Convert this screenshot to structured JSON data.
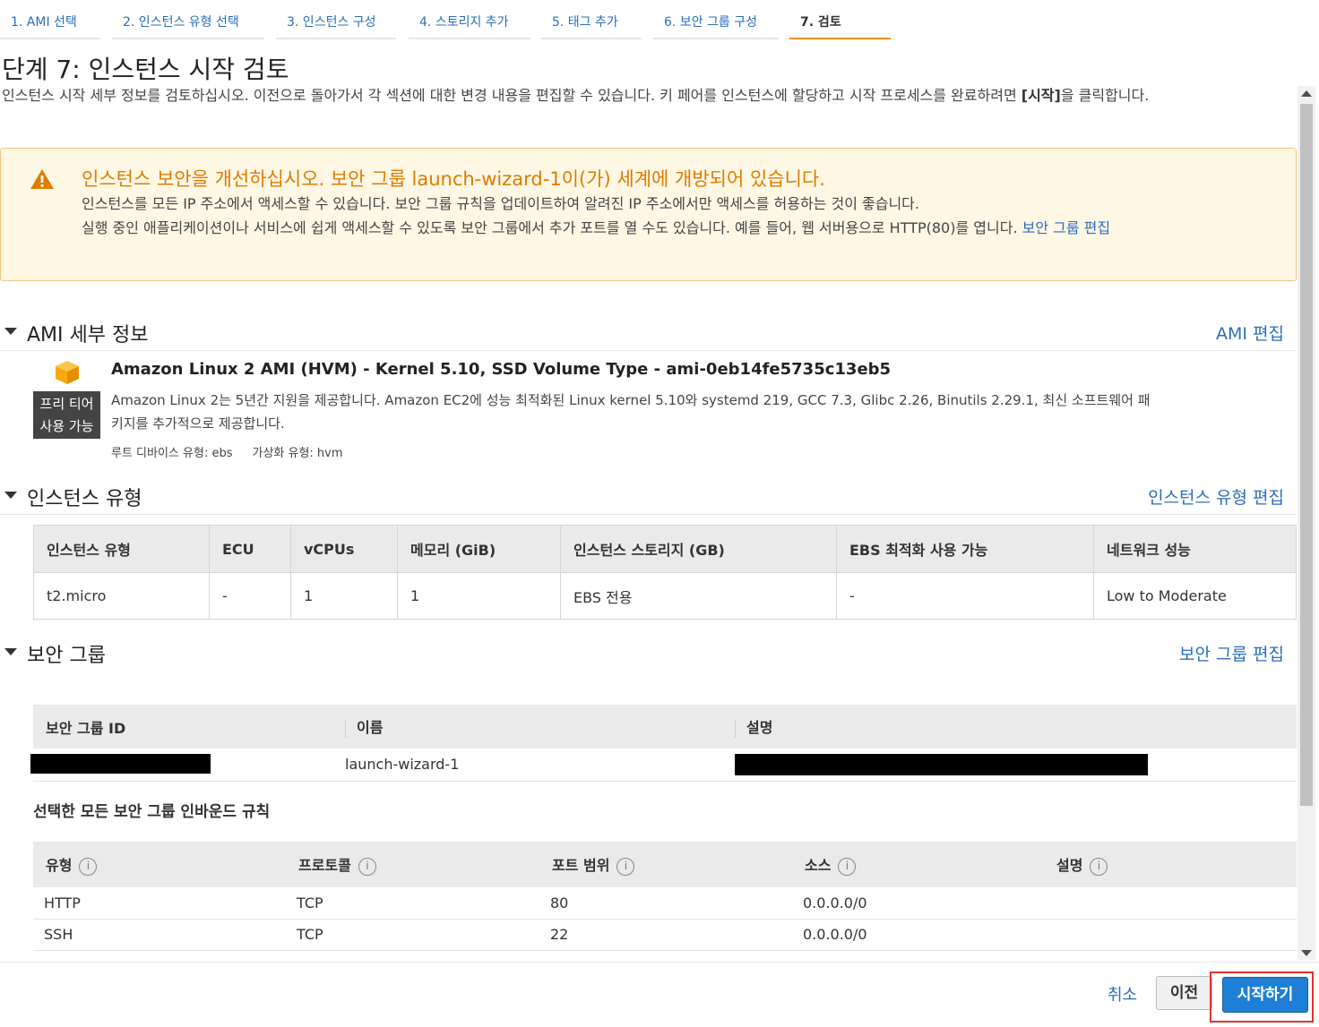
{
  "steps": [
    {
      "label": "1. AMI 선택"
    },
    {
      "label": "2. 인스턴스 유형 선택"
    },
    {
      "label": "3. 인스턴스 구성"
    },
    {
      "label": "4. 스토리지 추가"
    },
    {
      "label": "5. 태그 추가"
    },
    {
      "label": "6. 보안 그룹 구성"
    },
    {
      "label": "7. 검토"
    }
  ],
  "header": {
    "title": "단계 7: 인스턴스 시작 검토",
    "desc_before": "인스턴스 시작 세부 정보를 검토하십시오. 이전으로 돌아가서 각 섹션에 대한 변경 내용을 편집할 수 있습니다. 키 페어를 인스턴스에 할당하고 시작 프로세스를 완료하려면 ",
    "desc_bold": "[시작]",
    "desc_after": "을 클릭합니다."
  },
  "warning": {
    "title": "인스턴스 보안을 개선하십시오. 보안 그룹 launch-wizard-1이(가) 세계에 개방되어 있습니다.",
    "line1": "인스턴스를 모든 IP 주소에서 액세스할 수 있습니다. 보안 그룹 규칙을 업데이트하여 알려진 IP 주소에서만 액세스를 허용하는 것이 좋습니다.",
    "line2": "실행 중인 애플리케이션이나 서비스에 쉽게 액세스할 수 있도록 보안 그룹에서 추가 포트를 열 수도 있습니다. 예를 들어, 웹 서버용으로 HTTP(80)를 엽니다. ",
    "link": "보안 그룹 편집"
  },
  "ami": {
    "section_title": "AMI 세부 정보",
    "edit_label": "AMI 편집",
    "badge_line1": "프리 티어",
    "badge_line2": "사용 가능",
    "name": "Amazon Linux 2 AMI (HVM) - Kernel 5.10, SSD Volume Type - ami-0eb14fe5735c13eb5",
    "description": "Amazon Linux 2는 5년간 지원을 제공합니다. Amazon EC2에 성능 최적화된 Linux kernel 5.10와 systemd 219, GCC 7.3, Glibc 2.26, Binutils 2.29.1, 최신 소프트웨어 패키지를 추가적으로 제공합니다.",
    "root_device": "루트 디바이스 유형: ebs",
    "virtualization": "가상화 유형: hvm",
    "icon_color": "#f7a80d"
  },
  "instance_type": {
    "section_title": "인스턴스 유형",
    "edit_label": "인스턴스 유형 편집",
    "columns": [
      "인스턴스 유형",
      "ECU",
      "vCPUs",
      "메모리 (GiB)",
      "인스턴스 스토리지 (GB)",
      "EBS 최적화 사용 가능",
      "네트워크 성능"
    ],
    "row": [
      "t2.micro",
      "-",
      "1",
      "1",
      "EBS 전용",
      "-",
      "Low to Moderate"
    ]
  },
  "security_group": {
    "section_title": "보안 그룹",
    "edit_label": "보안 그룹 편집",
    "columns": [
      "보안 그룹 ID",
      "이름",
      "설명"
    ],
    "row_name": "launch-wizard-1",
    "rules_title": "선택한 모든 보안 그룹 인바운드 규칙",
    "rule_columns": [
      "유형",
      "프로토콜",
      "포트 범위",
      "소스",
      "설명"
    ],
    "rules": [
      [
        "HTTP",
        "TCP",
        "80",
        "0.0.0.0/0",
        ""
      ],
      [
        "SSH",
        "TCP",
        "22",
        "0.0.0.0/0",
        ""
      ]
    ]
  },
  "footer": {
    "cancel": "취소",
    "previous": "이전",
    "launch": "시작하기"
  },
  "colors": {
    "link": "#2a6ebb",
    "warning_title": "#e07b00",
    "active_step": "#f29100",
    "launch_button": "#1f7fd6",
    "highlight_outline": "#e53030"
  }
}
